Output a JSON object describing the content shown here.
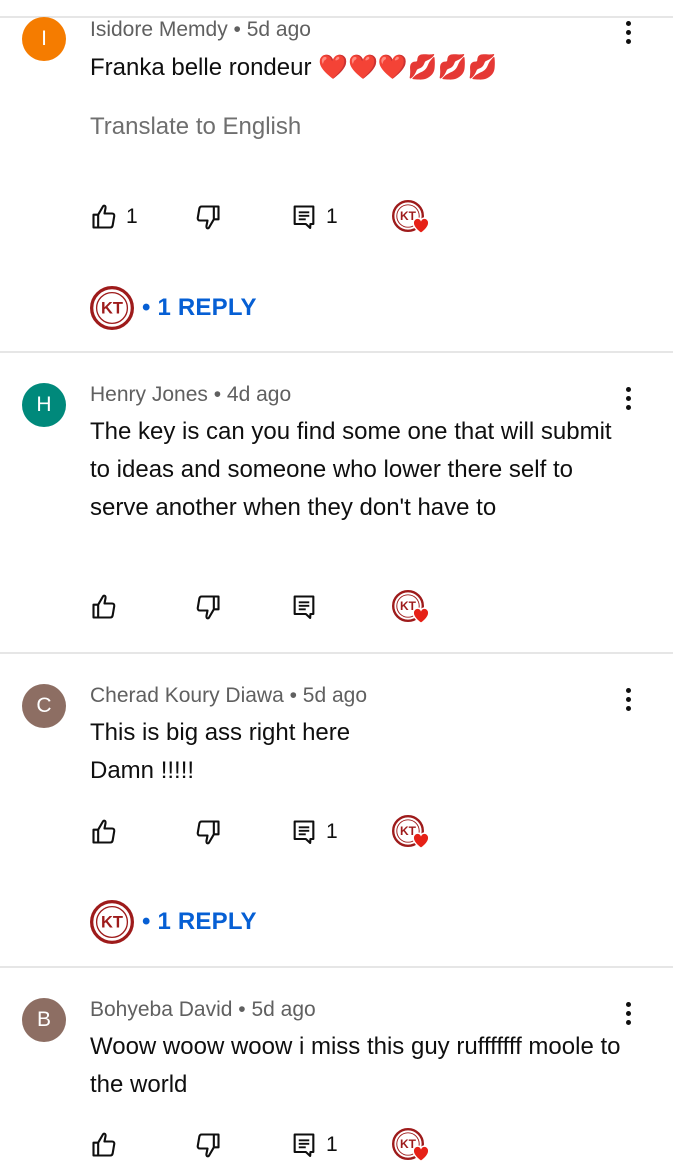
{
  "colors": {
    "accent": "#065fd4",
    "divider": "#e6e6e6",
    "meta_text": "#606060"
  },
  "icons": {
    "like": "thumb-up-outline",
    "dislike": "thumb-down-outline",
    "reply": "comment-outline",
    "creator_heart": "channel-avatar-with-red-heart",
    "menu": "vertical-three-dots"
  },
  "comments": [
    {
      "avatar_letter": "I",
      "avatar_color": "#f57c00",
      "meta": "Isidore Memdy • 5d ago",
      "text": "Franka belle rondeur ❤️❤️❤️💋💋💋",
      "translate": "Translate to English",
      "like_count": "1",
      "reply_count": "1",
      "replies_label": "• 1 REPLY"
    },
    {
      "avatar_letter": "H",
      "avatar_color": "#00897b",
      "meta": "Henry Jones • 4d ago",
      "text": "The key is can you find some one that will submit to ideas and someone who lower there self to serve another when they don't have to",
      "like_count": "",
      "reply_count": ""
    },
    {
      "avatar_letter": "C",
      "avatar_color": "#8d6e63",
      "meta": "Cherad Koury Diawa • 5d ago",
      "text_line1": "This is big ass right here",
      "text_line2": "Damn !!!!!",
      "like_count": "",
      "reply_count": "1",
      "replies_label": "• 1 REPLY"
    },
    {
      "avatar_letter": "B",
      "avatar_color": "#8d6e63",
      "meta": "Bohyeba David • 5d ago",
      "text": "Woow woow woow i miss this guy rufffffff moole to the world",
      "like_count": "",
      "reply_count": "1"
    }
  ]
}
